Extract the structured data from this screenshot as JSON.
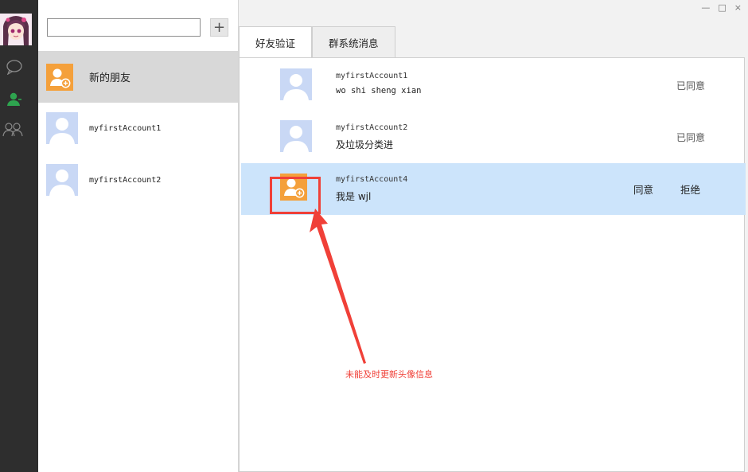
{
  "colors": {
    "rail_bg": "#2e2e2e",
    "accent_green": "#2ea44f",
    "selected_row": "#cce4fb",
    "annotation_red": "#f04038",
    "new_friend_orange": "#f4a03b",
    "default_avatar": "#c9d8f5"
  },
  "rail": {
    "icons": [
      "user-avatar",
      "chat-bubble-icon",
      "contact-icon",
      "group-icon"
    ]
  },
  "contacts": {
    "search_value": "",
    "add_label": "+",
    "items": [
      {
        "label": "新的朋友",
        "icon": "new-friend-icon"
      },
      {
        "label": "myfirstAccount1",
        "icon": "default-avatar-icon"
      },
      {
        "label": "myfirstAccount2",
        "icon": "default-avatar-icon"
      }
    ]
  },
  "window": {
    "minimize": "—",
    "maximize": "□",
    "close": "×"
  },
  "tabs": [
    {
      "label": "好友验证"
    },
    {
      "label": "群系统消息"
    }
  ],
  "requests": [
    {
      "name": "myfirstAccount1",
      "message": "wo shi sheng xian",
      "status": "已同意"
    },
    {
      "name": "myfirstAccount2",
      "message": "及垃圾分类进",
      "status": "已同意"
    },
    {
      "name": "myfirstAccount4",
      "message": "我是 wjl",
      "agree": "同意",
      "reject": "拒绝"
    }
  ],
  "annotation": {
    "text": "未能及时更新头像信息"
  }
}
